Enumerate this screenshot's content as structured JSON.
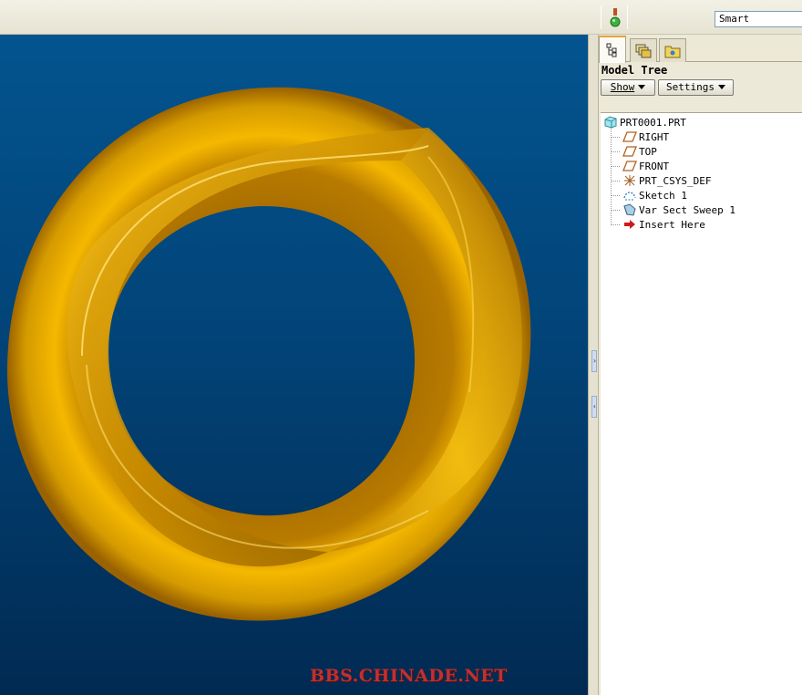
{
  "toolbar": {
    "search_filter": "Smart"
  },
  "viewport": {
    "watermark": "BBS.CHINADE.NET",
    "model_color": "#e8a810"
  },
  "navigator": {
    "tabs": [
      "model-tree-tab",
      "layers-tab",
      "folder-browser-tab"
    ],
    "title": "Model Tree",
    "show_button": "Show",
    "settings_button": "Settings"
  },
  "model_tree": {
    "root": "PRT0001.PRT",
    "items": [
      {
        "label": "RIGHT",
        "icon": "datum-plane-icon"
      },
      {
        "label": "TOP",
        "icon": "datum-plane-icon"
      },
      {
        "label": "FRONT",
        "icon": "datum-plane-icon"
      },
      {
        "label": "PRT_CSYS_DEF",
        "icon": "coordinate-system-icon"
      },
      {
        "label": "Sketch 1",
        "icon": "sketch-icon"
      },
      {
        "label": "Var Sect Sweep 1",
        "icon": "sweep-feature-icon"
      },
      {
        "label": "Insert Here",
        "icon": "insert-arrow-icon"
      }
    ]
  }
}
